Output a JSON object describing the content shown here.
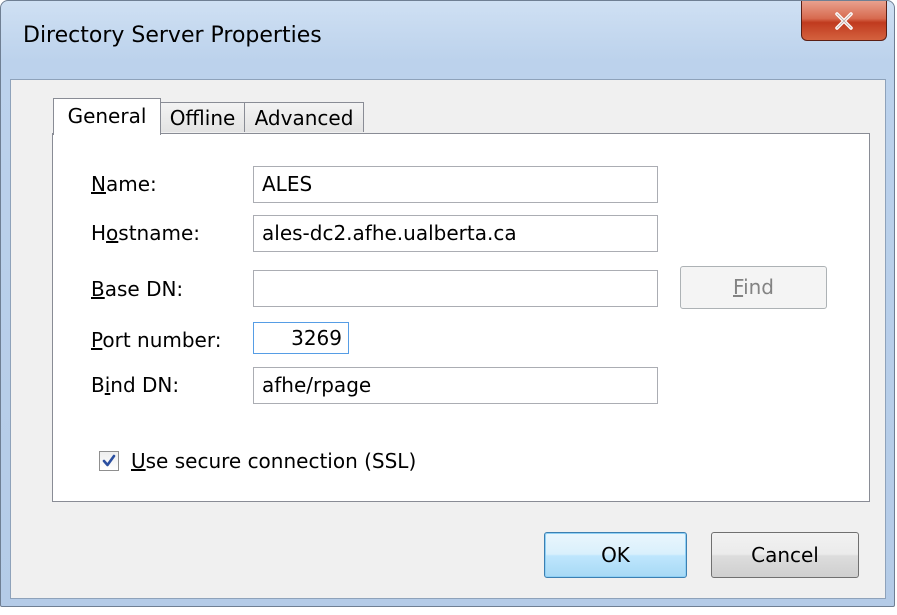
{
  "window": {
    "title": "Directory Server Properties",
    "close_label": "X"
  },
  "tabs": [
    {
      "label": "General",
      "active": true
    },
    {
      "label": "Offline",
      "active": false
    },
    {
      "label": "Advanced",
      "active": false
    }
  ],
  "form": {
    "name": {
      "label_mnemonic": "N",
      "label_rest": "ame:",
      "value": "ALES"
    },
    "hostname": {
      "label_pre": "H",
      "label_mnemonic": "o",
      "label_rest": "stname:",
      "value": "ales-dc2.afhe.ualberta.ca"
    },
    "base_dn": {
      "label_mnemonic": "B",
      "label_rest": "ase DN:",
      "value": ""
    },
    "port": {
      "label_mnemonic": "P",
      "label_rest": "ort number:",
      "value": "3269"
    },
    "bind_dn": {
      "label_pre": "B",
      "label_mnemonic": "i",
      "label_rest": "nd DN:",
      "value": "afhe/rpage"
    },
    "find_button": {
      "label_mnemonic": "F",
      "label_rest": "ind",
      "enabled": false
    },
    "ssl": {
      "label_mnemonic": "U",
      "label_rest": "se secure connection (SSL)",
      "checked": true
    }
  },
  "buttons": {
    "ok": "OK",
    "cancel": "Cancel"
  },
  "colors": {
    "title_bar": "#c4d7ef",
    "close_button": "#c8452a",
    "default_button_border": "#3c7fb1",
    "checkbox_check": "#2b4fa0"
  }
}
